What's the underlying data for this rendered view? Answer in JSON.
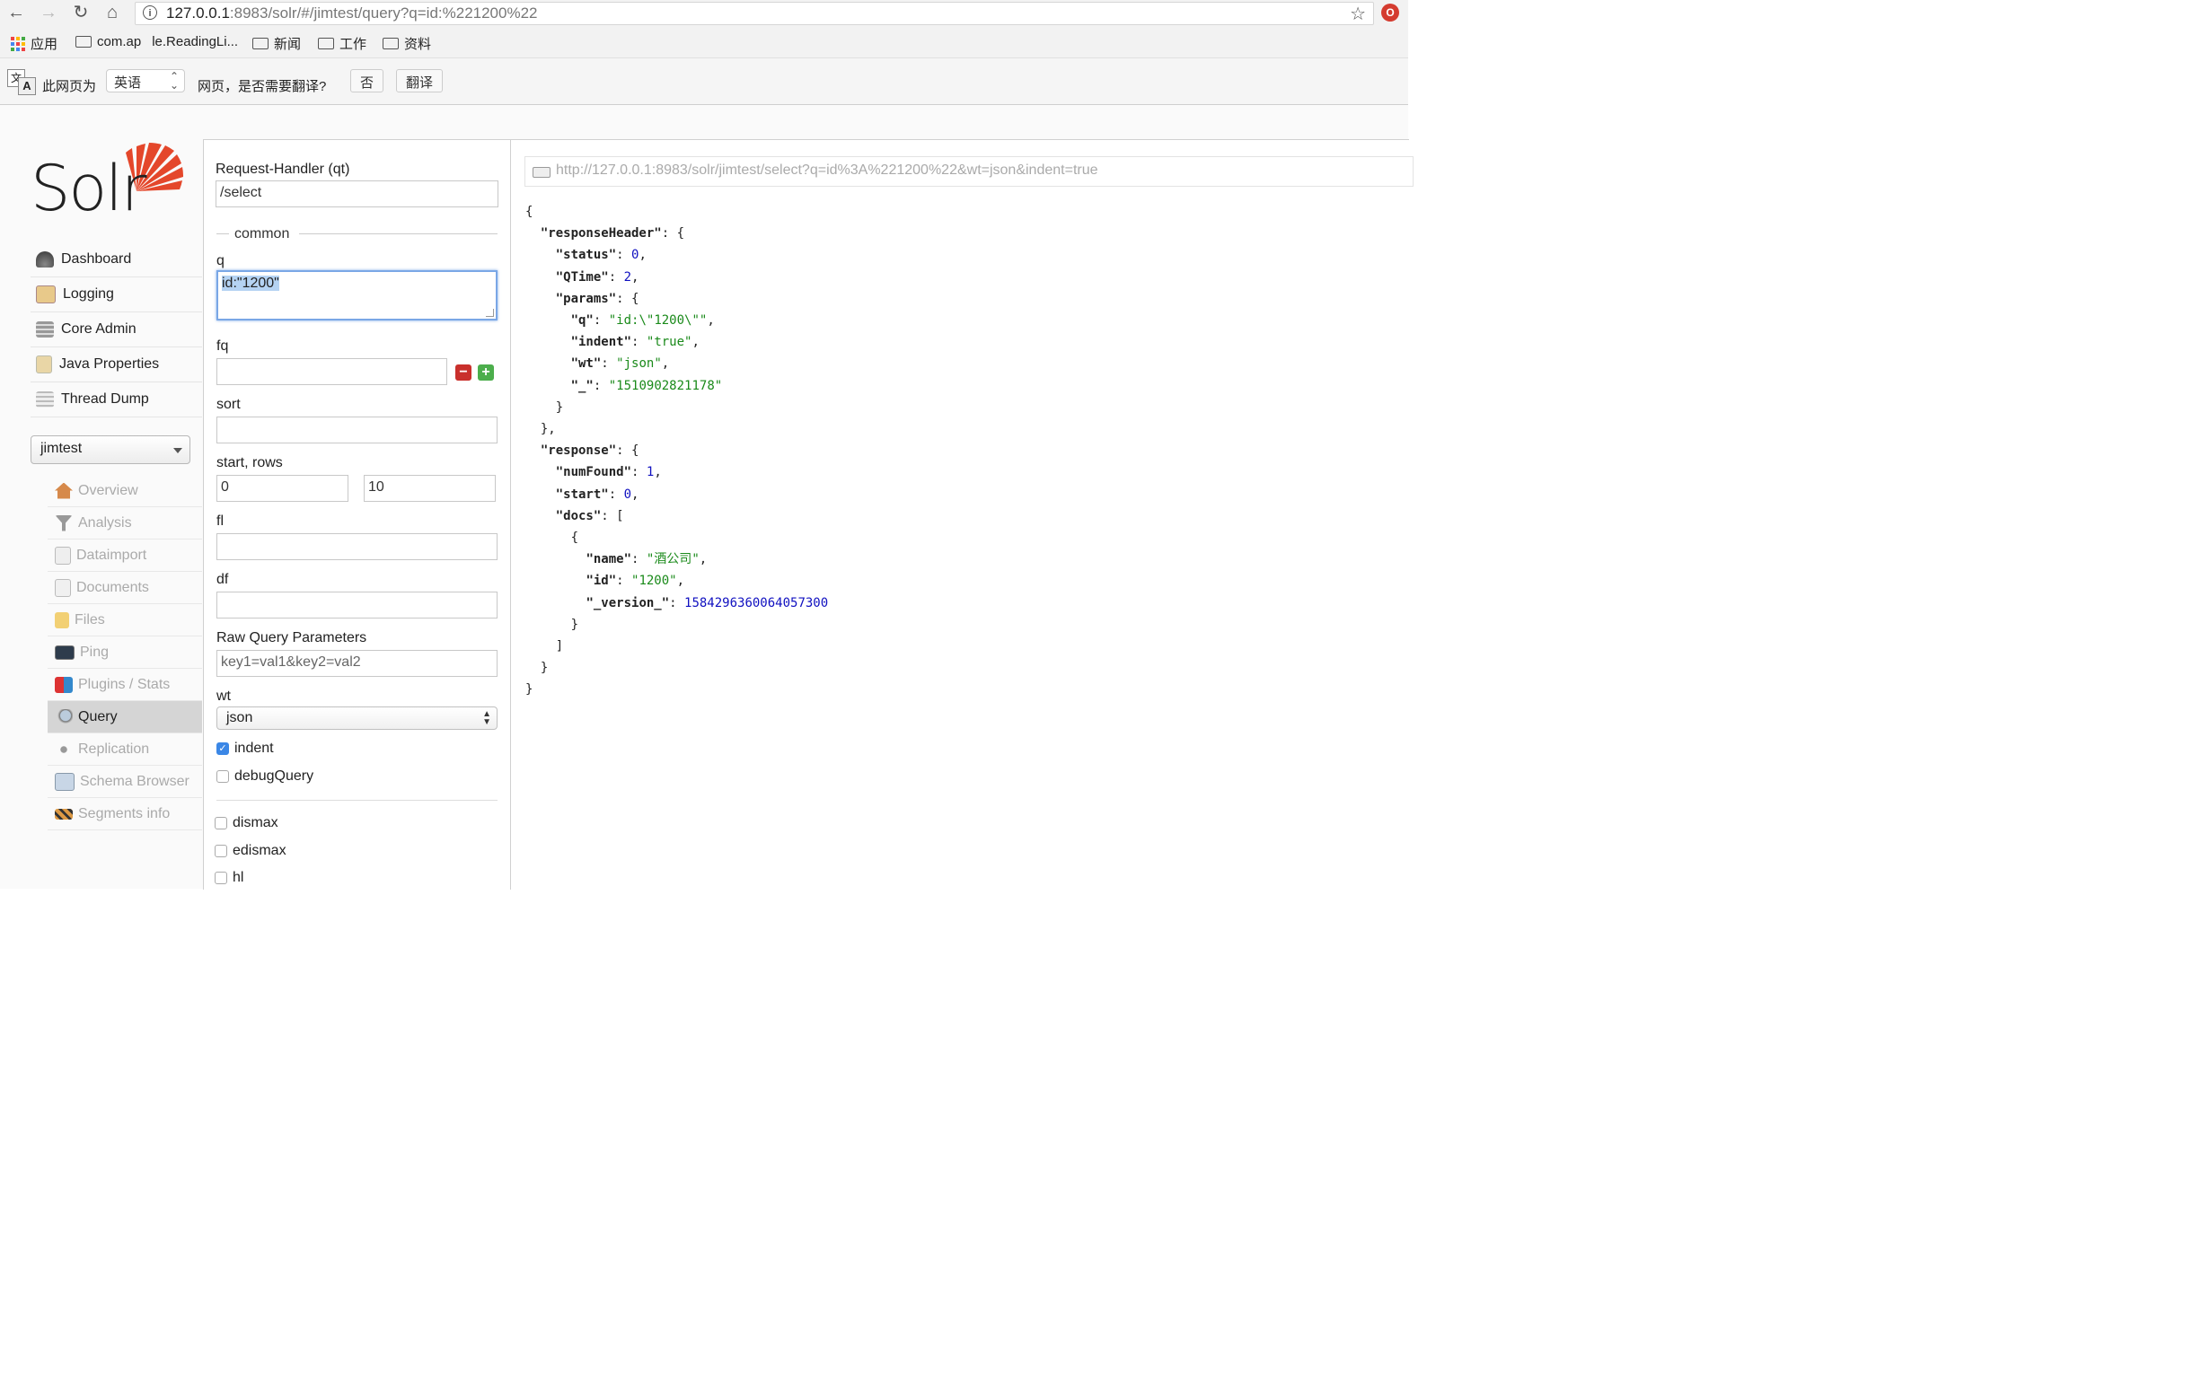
{
  "browser": {
    "url_host": "127.0.0.1",
    "url_rest": ":8983/solr/#/jimtest/query?q=id:%221200%22",
    "bookmarks": [
      "应用",
      "com.ap",
      "le.ReadingLi...",
      "新闻",
      "工作",
      "资料"
    ]
  },
  "translate": {
    "prefix": "此网页为",
    "language": "英语",
    "question": "网页，是否需要翻译?",
    "no_label": "否",
    "translate_label": "翻译"
  },
  "logo": {
    "text": "Solr"
  },
  "main_nav": [
    "Dashboard",
    "Logging",
    "Core Admin",
    "Java Properties",
    "Thread Dump"
  ],
  "core_selector": {
    "value": "jimtest"
  },
  "core_nav": [
    {
      "label": "Overview",
      "icon": "house-icon"
    },
    {
      "label": "Analysis",
      "icon": "funnel-icon"
    },
    {
      "label": "Dataimport",
      "icon": "import-icon"
    },
    {
      "label": "Documents",
      "icon": "documents-icon"
    },
    {
      "label": "Files",
      "icon": "folder-icon"
    },
    {
      "label": "Ping",
      "icon": "monitor-icon"
    },
    {
      "label": "Plugins / Stats",
      "icon": "blocks-icon"
    },
    {
      "label": "Query",
      "icon": "magnifier-icon"
    },
    {
      "label": "Replication",
      "icon": "replication-icon"
    },
    {
      "label": "Schema Browser",
      "icon": "book-icon"
    },
    {
      "label": "Segments info",
      "icon": "barrier-icon"
    }
  ],
  "active_core_nav": "Query",
  "form": {
    "handler_label": "Request-Handler (qt)",
    "handler_value": "/select",
    "common_label": "common",
    "q_label": "q",
    "q_value": "id:\"1200\"",
    "fq_label": "fq",
    "fq_value": "",
    "sort_label": "sort",
    "sort_value": "",
    "start_rows_label": "start, rows",
    "start_value": "0",
    "rows_value": "10",
    "fl_label": "fl",
    "fl_value": "",
    "df_label": "df",
    "df_value": "",
    "raw_label": "Raw Query Parameters",
    "raw_placeholder": "key1=val1&key2=val2",
    "wt_label": "wt",
    "wt_value": "json",
    "indent_label": "indent",
    "indent_checked": true,
    "debug_label": "debugQuery",
    "debug_checked": false,
    "dismax_label": "dismax",
    "edismax_label": "edismax",
    "hl_label": "hl"
  },
  "result": {
    "request_url": "http://127.0.0.1:8983/solr/jimtest/select?q=id%3A%221200%22&wt=json&indent=true",
    "response": {
      "responseHeader": {
        "status": 0,
        "QTime": 2,
        "params": {
          "q": "id:\\\"1200\\\"",
          "indent": "true",
          "wt": "json",
          "_": "1510902821178"
        }
      },
      "response": {
        "numFound": 1,
        "start": 0,
        "docs": [
          {
            "name": "酒公司",
            "id": "1200",
            "_version_": "1584296360064057300"
          }
        ]
      }
    }
  },
  "colors": {
    "json_string": "#1a8a1a",
    "json_number": "#1010c0",
    "logo_accent": "#e4472b",
    "active_nav_bg": "#d5d5d5",
    "focus_border": "#7aa7e6"
  }
}
